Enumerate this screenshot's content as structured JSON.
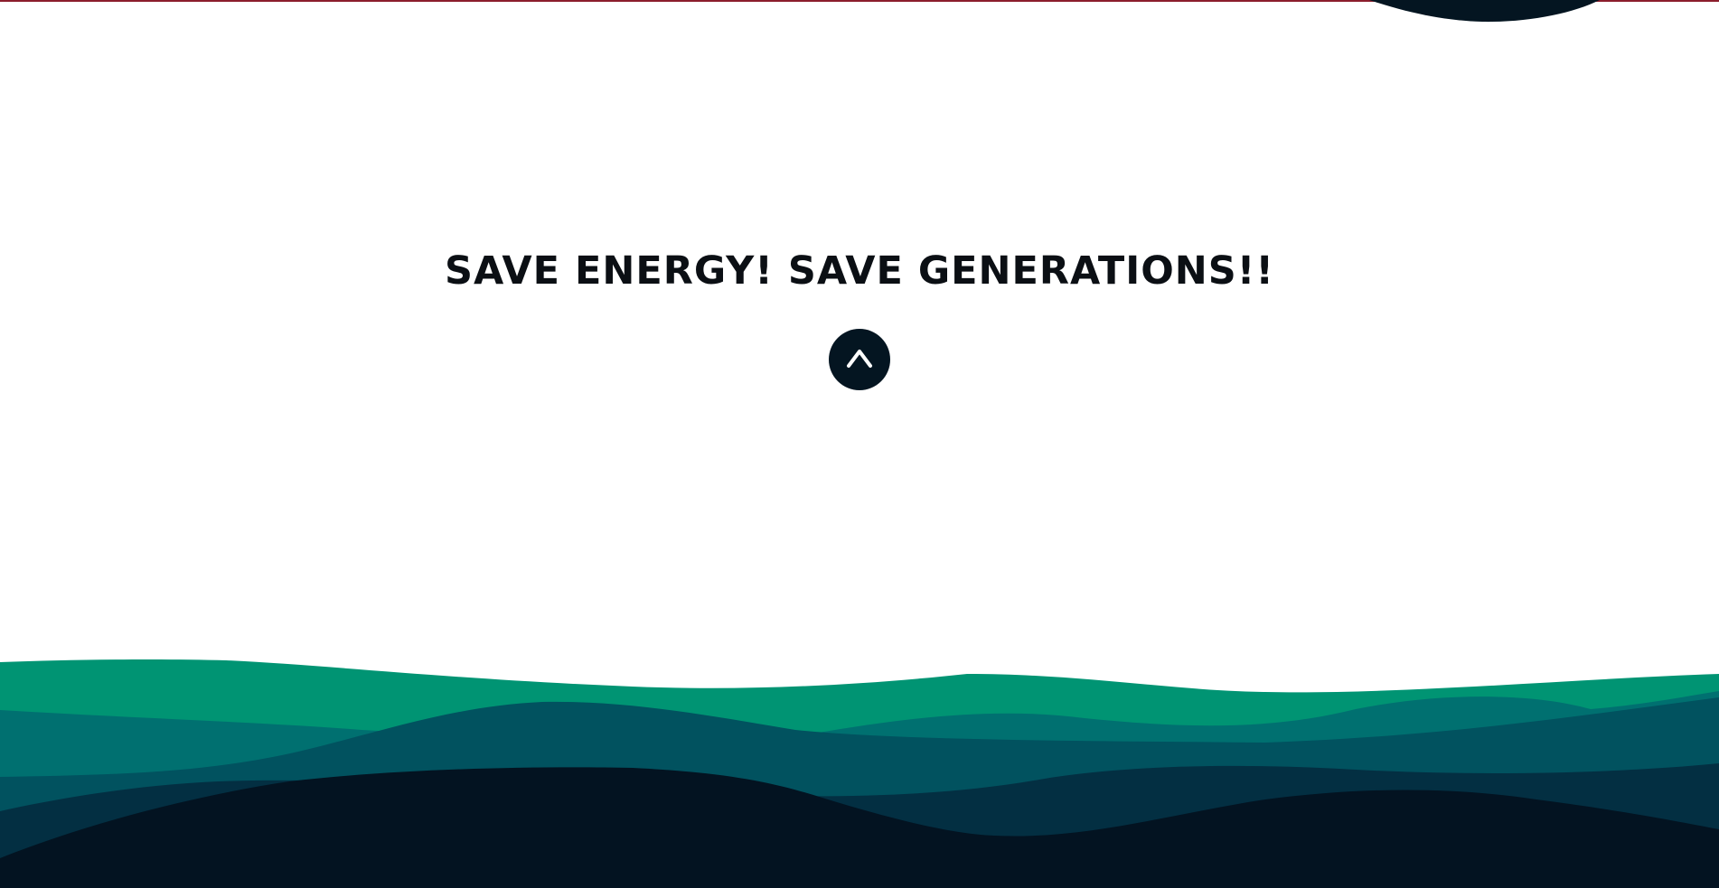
{
  "hero": {
    "slogan": "SAVE ENERGY! SAVE GENERATIONS!!"
  },
  "scroll_top_button": {
    "icon": "chevron-up-icon"
  },
  "colors": {
    "top_line": "#8b1e2c",
    "navy": "#041521",
    "wave_green": "#009473",
    "wave_teal": "#007070",
    "wave_petrol": "#01525f",
    "wave_dark_teal": "#032f42",
    "wave_navy": "#031321"
  }
}
